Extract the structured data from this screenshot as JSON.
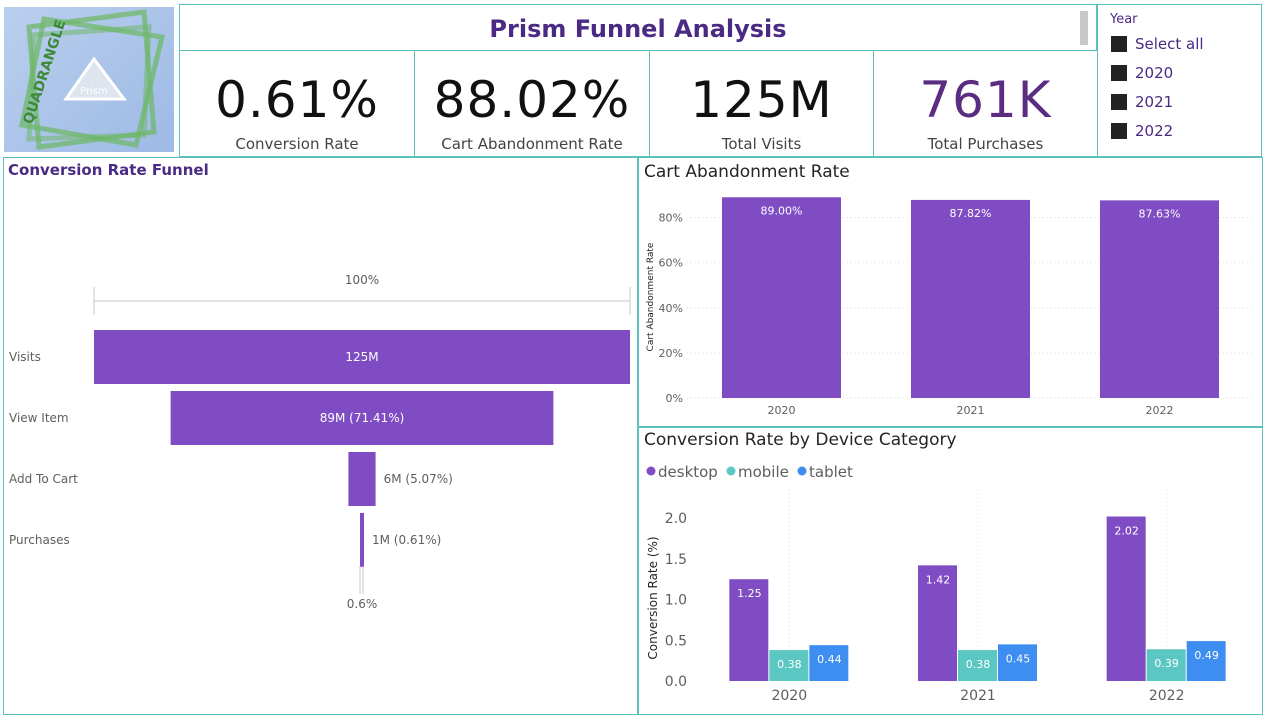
{
  "logo": {
    "brand": "QUADRANGLE",
    "product": "Prism"
  },
  "header": {
    "title": "Prism Funnel Analysis"
  },
  "kpis": [
    {
      "value": "0.61%",
      "label": "Conversion Rate",
      "color": "#111111"
    },
    {
      "value": "88.02%",
      "label": "Cart Abandonment Rate",
      "color": "#111111"
    },
    {
      "value": "125M",
      "label": "Total Visits",
      "color": "#111111"
    },
    {
      "value": "761K",
      "label": "Total Purchases",
      "color": "#5a2c82"
    }
  ],
  "slicer": {
    "title": "Year",
    "items": [
      "Select all",
      "2020",
      "2021",
      "2022"
    ]
  },
  "colors": {
    "purple": "#7f4cc4",
    "teal": "#5bc7c3",
    "blue": "#3d8ef0",
    "border": "#5bc0be"
  },
  "chart_data": [
    {
      "type": "bar",
      "title": "Conversion Rate Funnel",
      "categories": [
        "Visits",
        "View Item",
        "Add To Cart",
        "Purchases"
      ],
      "values": [
        125,
        89,
        6,
        1
      ],
      "percent_of_first": [
        100,
        71.41,
        5.07,
        0.61
      ],
      "data_labels": [
        "125M",
        "89M (71.41%)",
        "6M (5.07%)",
        "1M (0.61%)"
      ],
      "top_label": "100%",
      "bottom_label": "0.6%"
    },
    {
      "type": "bar",
      "title": "Cart Abandonment Rate",
      "categories": [
        "2020",
        "2021",
        "2022"
      ],
      "values": [
        89.0,
        87.82,
        87.63
      ],
      "data_labels": [
        "89.00%",
        "87.82%",
        "87.63%"
      ],
      "ylabel": "Cart Abandonment Rate",
      "yticks": [
        "0%",
        "20%",
        "40%",
        "60%",
        "80%"
      ],
      "ylim": [
        0,
        90
      ],
      "grid": true
    },
    {
      "type": "bar",
      "title": "Conversion Rate by Device Category",
      "categories": [
        "2020",
        "2021",
        "2022"
      ],
      "series": [
        {
          "name": "desktop",
          "values": [
            1.25,
            1.42,
            2.02
          ]
        },
        {
          "name": "mobile",
          "values": [
            0.38,
            0.38,
            0.39
          ]
        },
        {
          "name": "tablet",
          "values": [
            0.44,
            0.45,
            0.49
          ]
        }
      ],
      "ylabel": "Conversion Rate (%)",
      "yticks": [
        "0.0",
        "0.5",
        "1.0",
        "1.5",
        "2.0"
      ],
      "ylim": [
        0,
        2.1
      ],
      "legend": "top-left",
      "grid": true
    }
  ]
}
